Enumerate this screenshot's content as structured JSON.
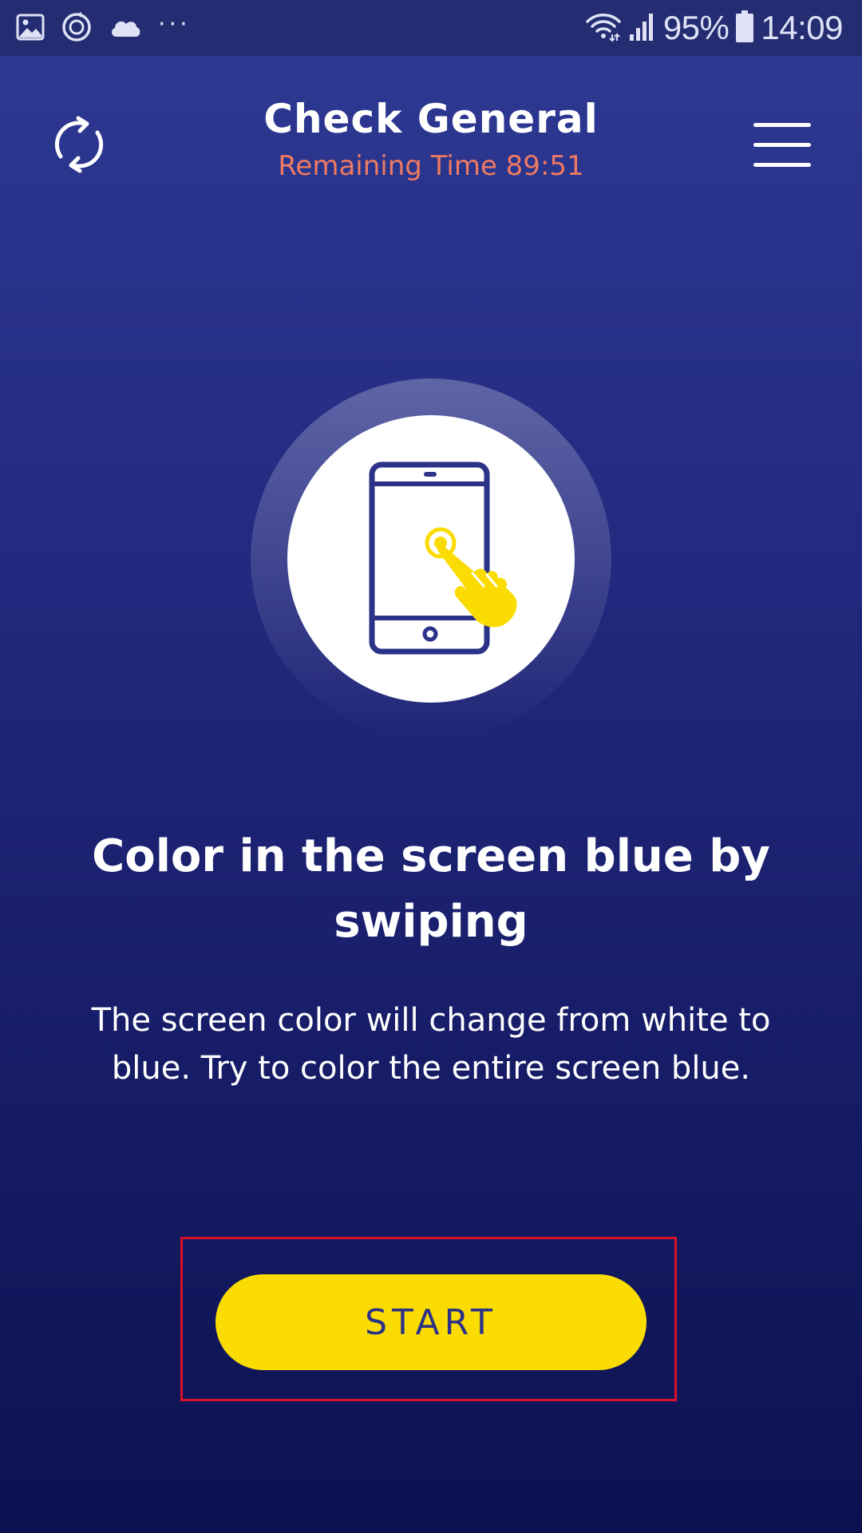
{
  "status_bar": {
    "battery_text": "95%",
    "time": "14:09",
    "more_indicator": "···",
    "icons": [
      "gallery-icon",
      "sync-icon",
      "cloud-icon",
      "wifi-icon",
      "signal-icon",
      "battery-icon"
    ]
  },
  "header": {
    "title": "Check General",
    "subtitle": "Remaining Time 89:51",
    "left_icon": "refresh-icon",
    "right_icon": "menu-icon"
  },
  "illustration": {
    "icon": "phone-tap-icon"
  },
  "instruction": {
    "title": "Color in the screen blue by swiping",
    "body": "The screen color will change from white to blue. Try to color the entire screen blue."
  },
  "actions": {
    "start_label": "START"
  },
  "colors": {
    "background_top": "#2e3a94",
    "background_bottom": "#0c1250",
    "accent_yellow": "#fbdc02",
    "subtitle_coral": "#ee7a62",
    "icon_navy": "#2c3287",
    "highlight_red": "#d8102b"
  }
}
